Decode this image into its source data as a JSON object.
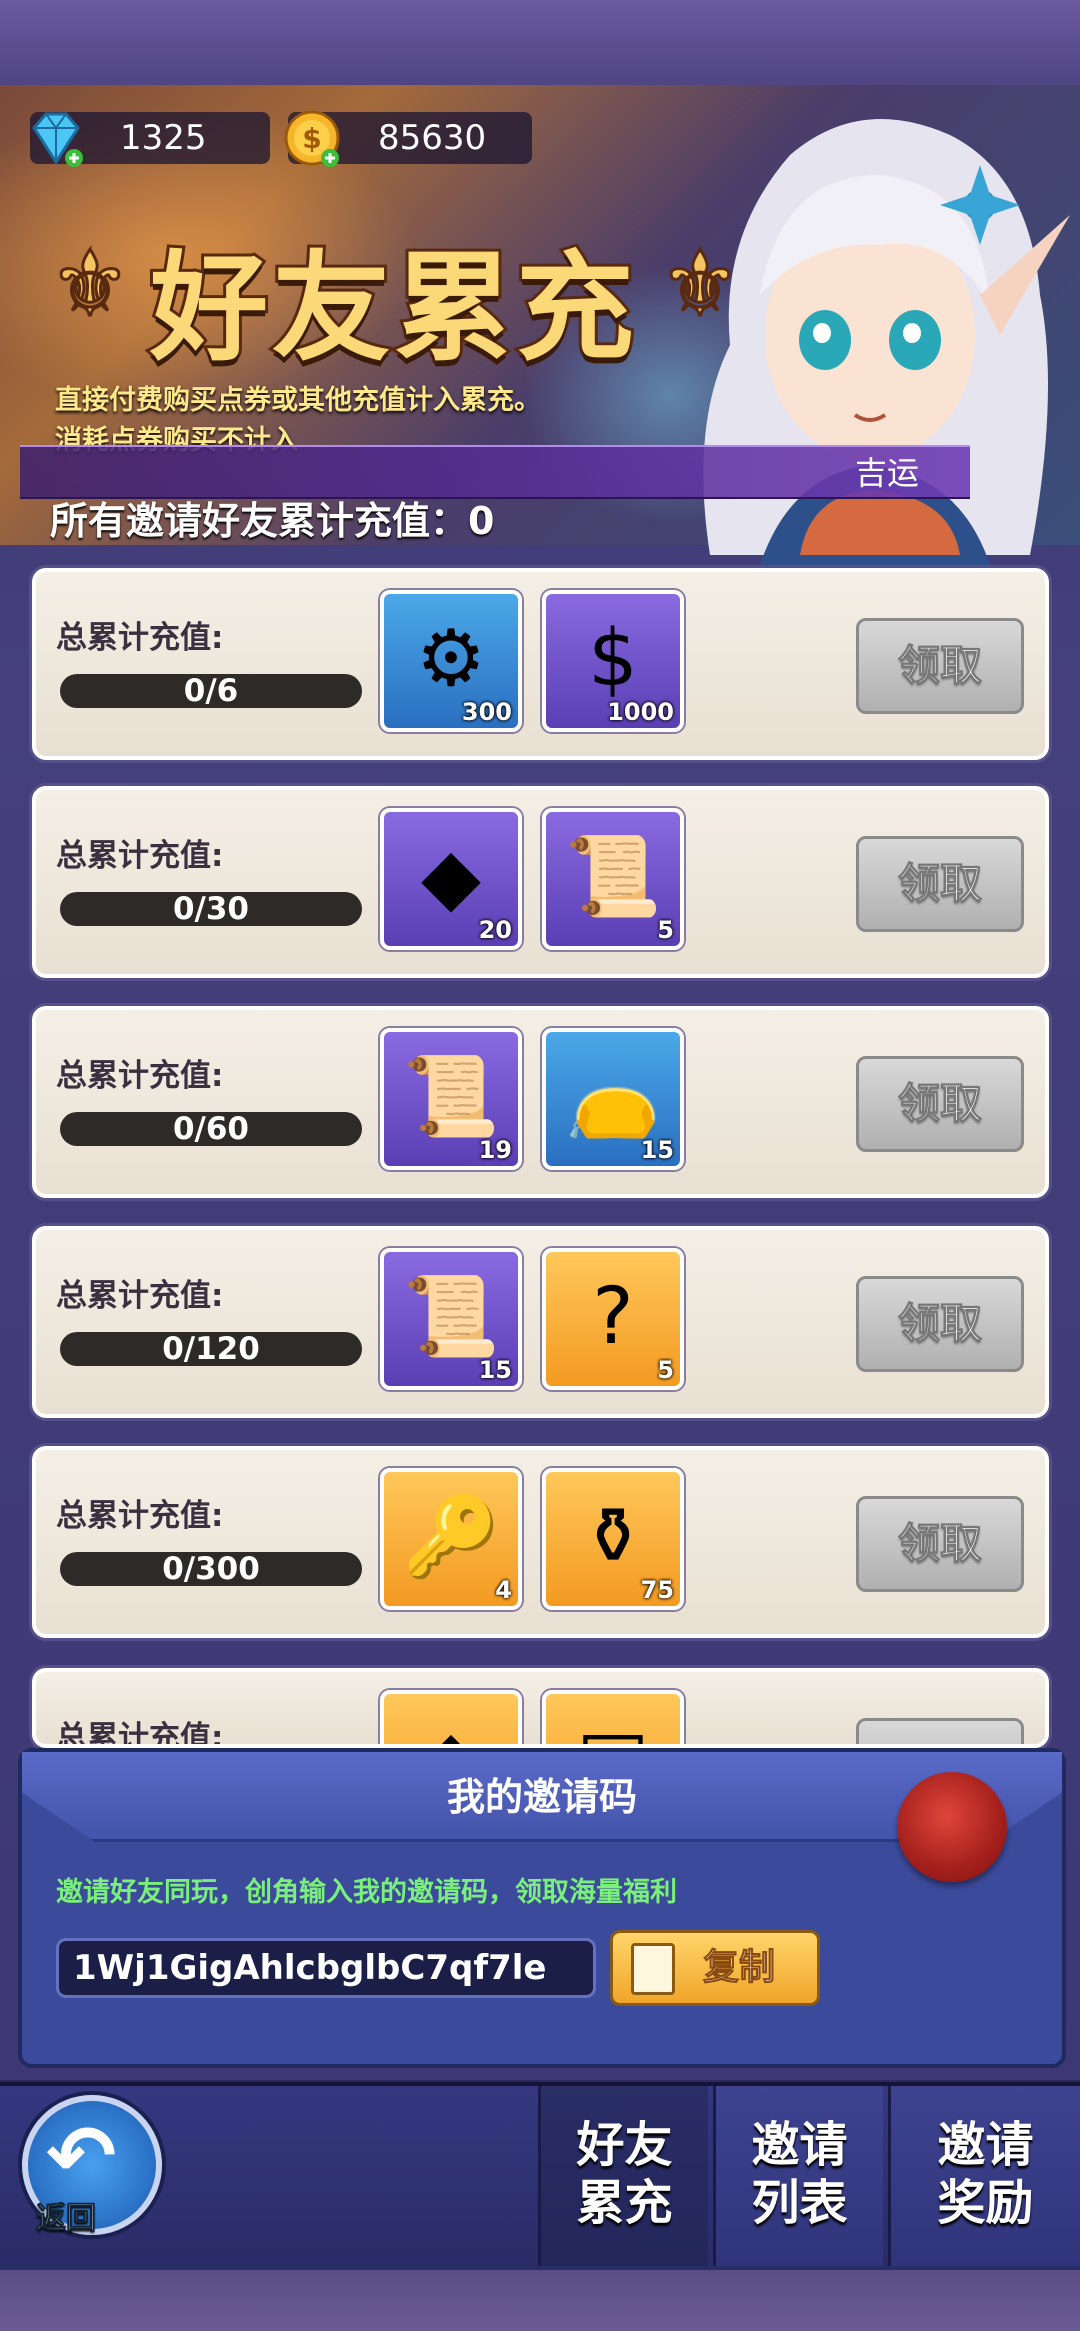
{
  "currency": {
    "diamonds": "1325",
    "coins": "85630"
  },
  "header": {
    "title": "好友累充",
    "subtitle_line1": "直接付费购买点券或其他充值计入累充。",
    "subtitle_line2": "消耗点券购买不计入",
    "lucky": "吉运",
    "total": "所有邀请好友累计充值：0"
  },
  "tiers": [
    {
      "label": "总累计充值:",
      "progress": "0/6",
      "claim": "领取",
      "rewards": [
        {
          "icon": "sawblade-icon",
          "count": "300",
          "color": "blue"
        },
        {
          "icon": "gold-coin-icon",
          "count": "1000",
          "color": "purple"
        }
      ]
    },
    {
      "label": "总累计充值:",
      "progress": "0/30",
      "claim": "领取",
      "rewards": [
        {
          "icon": "rune-stone-icon",
          "count": "20",
          "color": "purple"
        },
        {
          "icon": "scroll-icon",
          "count": "5",
          "color": "purple"
        }
      ]
    },
    {
      "label": "总累计充值:",
      "progress": "0/60",
      "claim": "领取",
      "rewards": [
        {
          "icon": "blue-scroll-icon",
          "count": "19",
          "color": "purple"
        },
        {
          "icon": "pouch-icon",
          "count": "15",
          "color": "blue"
        }
      ]
    },
    {
      "label": "总累计充值:",
      "progress": "0/120",
      "claim": "领取",
      "rewards": [
        {
          "icon": "rolled-scroll-icon",
          "count": "15",
          "color": "purple"
        },
        {
          "icon": "mystery-puzzle-icon",
          "count": "5",
          "color": "orange"
        }
      ]
    },
    {
      "label": "总累计充值:",
      "progress": "0/300",
      "claim": "领取",
      "rewards": [
        {
          "icon": "key-icon",
          "count": "4",
          "color": "orange"
        },
        {
          "icon": "dust-pot-icon",
          "count": "75",
          "color": "orange"
        }
      ]
    },
    {
      "label": "总累计充值:",
      "progress": "",
      "claim": "",
      "rewards": [
        {
          "icon": "diamond-icon",
          "count": "",
          "color": "orange"
        },
        {
          "icon": "chest-icon",
          "count": "",
          "color": "orange"
        }
      ]
    }
  ],
  "invite": {
    "title": "我的邀请码",
    "description": "邀请好友同玩，创角输入我的邀请码，领取海量福利",
    "code": "1Wj1GigAhlcbglbC7qf7le",
    "copy": "复制"
  },
  "nav": {
    "back": "返回",
    "tabs": [
      {
        "line1": "好友",
        "line2": "累充"
      },
      {
        "line1": "邀请",
        "line2": "列表"
      },
      {
        "line1": "邀请",
        "line2": "奖励"
      }
    ]
  }
}
